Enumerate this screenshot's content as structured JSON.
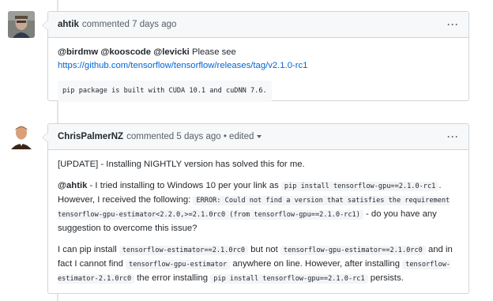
{
  "comments": [
    {
      "author": "ahtik",
      "meta": "commented 7 days ago",
      "menu": "···",
      "body": {
        "mentions": [
          "@birdmw",
          "@kooscode",
          "@levicki"
        ],
        "text_after_mentions": "Please see",
        "link": "https://github.com/tensorflow/tensorflow/releases/tag/v2.1.0-rc1",
        "code": "pip package is built with CUDA 10.1 and cuDNN 7.6."
      }
    },
    {
      "author": "ChrisPalmerNZ",
      "meta": "commented 5 days ago • edited",
      "menu": "···",
      "body": {
        "p1": "[UPDATE] - Installing NIGHTLY version has solved this for me.",
        "p2_mention": "@ahtik",
        "p2_t1": " - I tried installing to Windows 10 per your link as ",
        "p2_code1": "pip install tensorflow-gpu==2.1.0-rc1",
        "p2_t2": ". However, I received the following: ",
        "p2_code2": "ERROR: Could not find a version that satisfies the requirement tensorflow-gpu-estimator<2.2.0,>=2.1.0rc0 (from tensorflow-gpu==2.1.0-rc1)",
        "p2_t3": " - do you have any suggestion to overcome this issue?",
        "p3_t1": "I can pip install ",
        "p3_code1": "tensorflow-estimator==2.1.0rc0",
        "p3_t2": " but not ",
        "p3_code2": "tensorflow-gpu-estimator==2.1.0rc0",
        "p3_t3": " and in fact I cannot find ",
        "p3_code3": "tensorflow-gpu-estimator",
        "p3_t4": " anywhere on line. However, after installing ",
        "p3_code4": "tensorflow-estimator-2.1.0rc0",
        "p3_t5": " the error installing ",
        "p3_code5": "pip install tensorflow-gpu==2.1.0-rc1",
        "p3_t6": " persists."
      }
    }
  ]
}
